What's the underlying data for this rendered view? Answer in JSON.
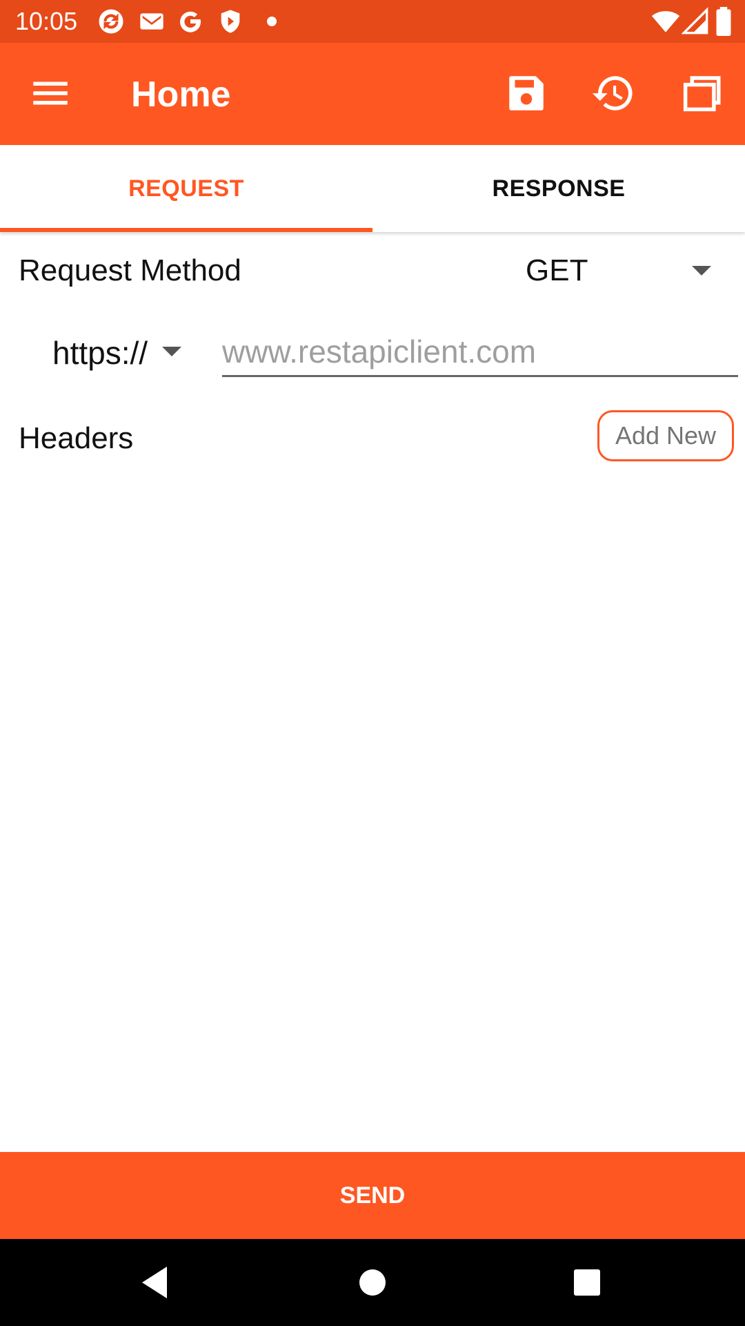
{
  "status_bar": {
    "time": "10:05",
    "notification_icons": [
      "sync-icon",
      "gmail-icon",
      "google-icon",
      "shield-icon",
      "dot-icon"
    ],
    "system_icons": [
      "wifi-icon",
      "cell-signal-icon",
      "battery-icon"
    ]
  },
  "app_bar": {
    "title": "Home",
    "actions": [
      "save-icon",
      "history-icon",
      "collections-icon"
    ]
  },
  "tabs": [
    {
      "label": "REQUEST",
      "active": true
    },
    {
      "label": "RESPONSE",
      "active": false
    }
  ],
  "request": {
    "method_label": "Request Method",
    "method_value": "GET",
    "scheme_value": "https://",
    "url_value": "",
    "url_placeholder": "www.restapiclient.com",
    "headers_label": "Headers",
    "add_new_label": "Add New"
  },
  "send_label": "SEND",
  "colors": {
    "primary": "#FF5722",
    "status_bar": "#E64A19",
    "nav_bar": "#000000"
  },
  "nav_bar": [
    "back-icon",
    "home-icon",
    "recents-icon"
  ]
}
